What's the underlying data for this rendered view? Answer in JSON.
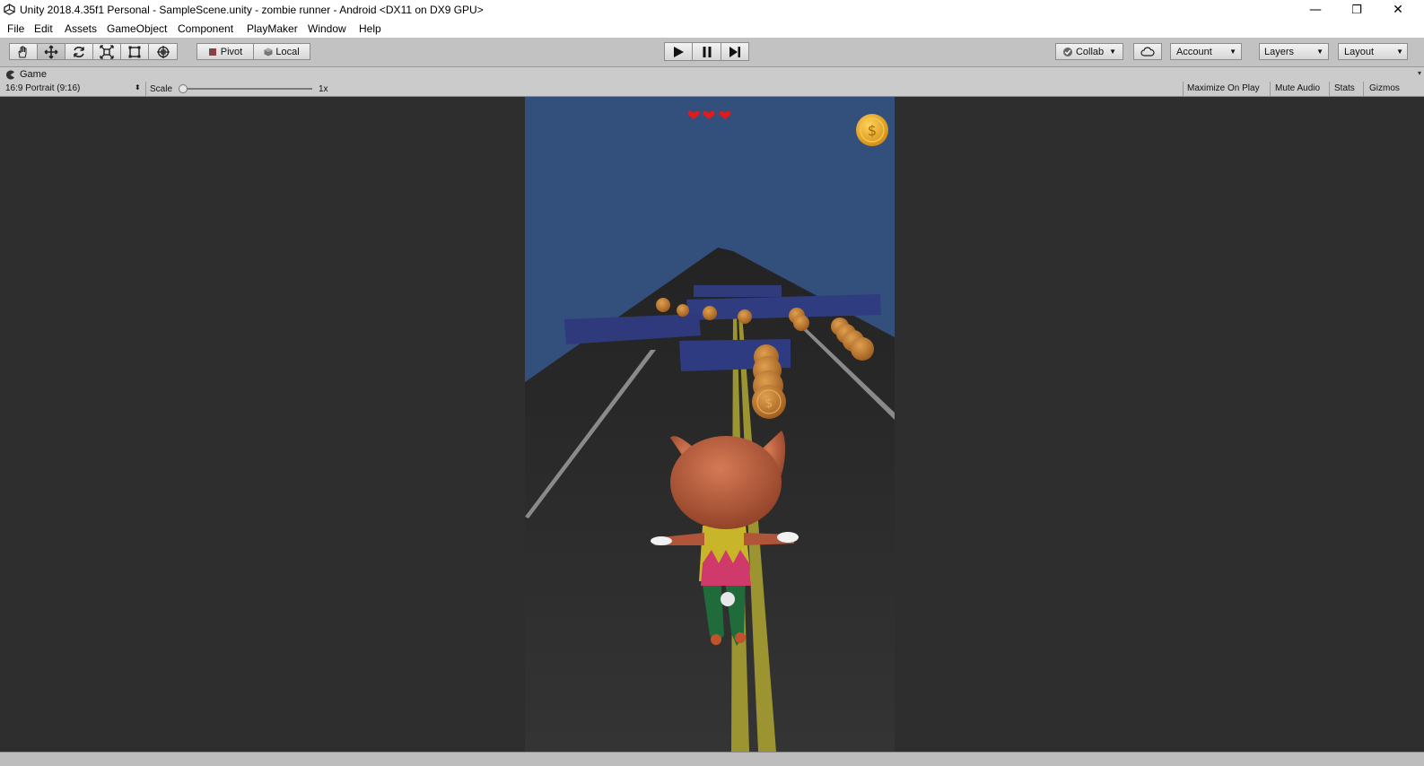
{
  "window": {
    "title": "Unity 2018.4.35f1 Personal - SampleScene.unity - zombie runner - Android <DX11 on DX9 GPU>",
    "controls": {
      "minimize": "—",
      "maximize": "❐",
      "close": "✕"
    }
  },
  "menu": {
    "items": [
      "File",
      "Edit",
      "Assets",
      "GameObject",
      "Component",
      "PlayMaker",
      "Window",
      "Help"
    ]
  },
  "toolbar": {
    "tools": [
      "hand-tool-icon",
      "move-tool-icon",
      "rotate-tool-icon",
      "scale-tool-icon",
      "rect-tool-icon",
      "transform-tool-icon"
    ],
    "active_tool": "move-tool-icon",
    "pivot_label": "Pivot",
    "local_label": "Local",
    "collab_label": "Collab",
    "account_label": "Account",
    "layers_label": "Layers",
    "layout_label": "Layout"
  },
  "game_view": {
    "tab_label": "Game",
    "resolution": "16:9 Portrait (9:16)",
    "scale_label": "Scale",
    "scale_value": "1x",
    "scale_level": 0,
    "maximize_on_play": "Maximize On Play",
    "mute_audio": "Mute Audio",
    "stats": "Stats",
    "gizmos": "Gizmos"
  },
  "hud": {
    "lives": 3,
    "coin_symbol": "$"
  },
  "colors": {
    "sky": "#334f7c",
    "road": "#2b2b2b",
    "coin": "#c07a2a",
    "coin_hud": "#e6a825",
    "heart": "#e01b1b",
    "obstacle": "#2f3b7a",
    "lane_line": "#9c9430"
  }
}
